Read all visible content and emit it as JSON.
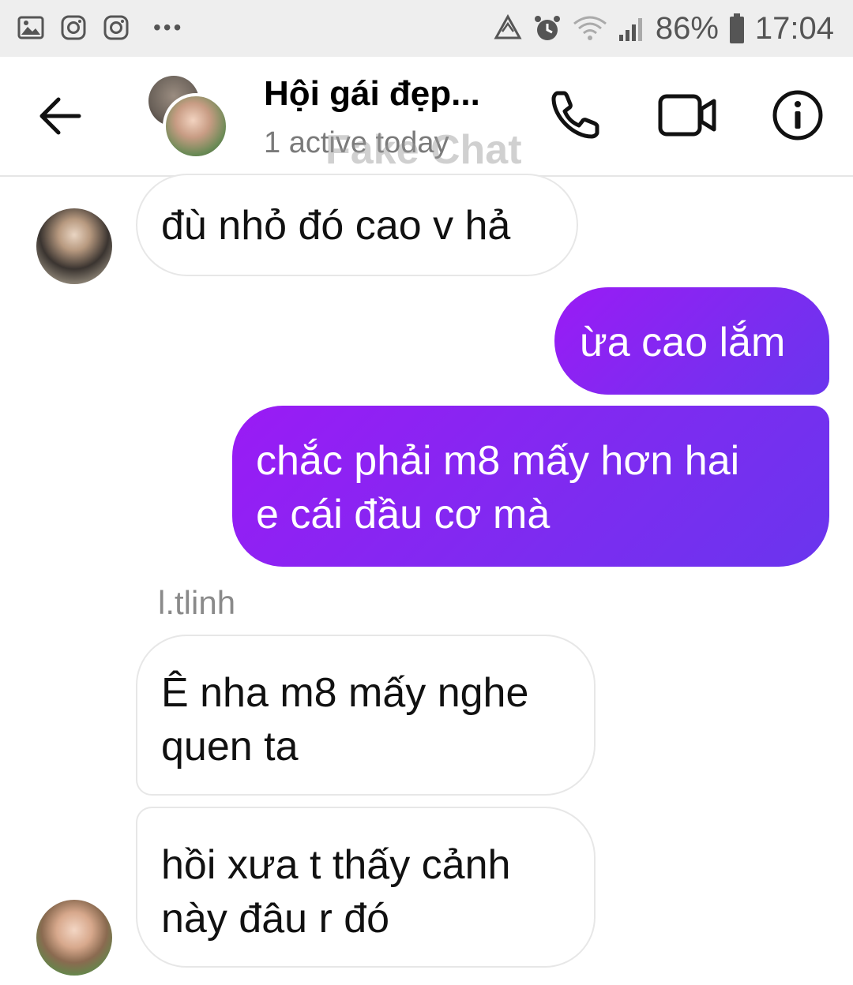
{
  "status_bar": {
    "battery": "86%",
    "time": "17:04",
    "icons": [
      "gallery-icon",
      "instagram-icon",
      "instagram-icon",
      "more-dots-icon",
      "recycle-icon",
      "alarm-icon",
      "wifi-icon",
      "signal-icon",
      "battery-icon"
    ]
  },
  "header": {
    "title": "Hội gái đẹp...",
    "subtitle": "1 active today",
    "watermark": "Fake Chat",
    "icons": [
      "back-arrow-icon",
      "phone-icon",
      "video-camera-icon",
      "info-icon"
    ]
  },
  "messages": [
    {
      "direction": "incoming",
      "text": "đù nhỏ đó cao v hả"
    },
    {
      "direction": "outgoing",
      "text": "ừa cao lắm"
    },
    {
      "direction": "outgoing",
      "lines": [
        "chắc phải m8 mấy hơn hai",
        "e cái đầu cơ mà"
      ]
    },
    {
      "direction": "incoming",
      "sender": "l.tlinh",
      "lines": [
        "Ê nha m8 mấy nghe",
        "quen ta"
      ]
    },
    {
      "direction": "incoming",
      "lines": [
        "hồi xưa t thấy cảnh",
        "này đâu r đó"
      ]
    }
  ],
  "colors": {
    "outgoing_bubble_start": "#9a1bf5",
    "outgoing_bubble_end": "#6a35ee",
    "incoming_border": "#e7e7e7",
    "status_bar_bg": "#eeeeee"
  }
}
